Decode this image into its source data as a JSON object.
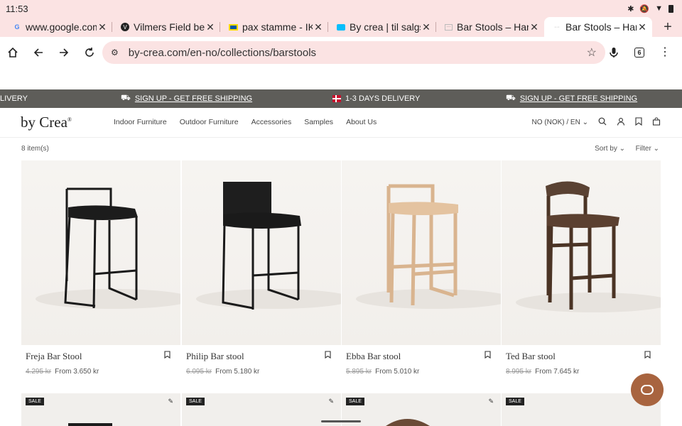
{
  "status": {
    "time": "11:53"
  },
  "tabs": [
    {
      "title": "www.google.com",
      "favicon": "google-icon"
    },
    {
      "title": "Vilmers Field beige",
      "favicon": "vilmers-icon"
    },
    {
      "title": "pax stamme - IKEA",
      "favicon": "ikea-icon"
    },
    {
      "title": "By crea | til salgs",
      "favicon": "finn-icon"
    },
    {
      "title": "Bar Stools – Handm",
      "favicon": "bycrea-icon"
    },
    {
      "title": "Bar Stools – Handm",
      "favicon": "bycrea-icon"
    }
  ],
  "toolbar": {
    "url": "by-crea.com/en-no/collections/barstools",
    "tab_count": "6"
  },
  "announcement": {
    "left_fragment": "LIVERY",
    "signup": "SIGN UP - GET FREE SHIPPING",
    "delivery": "1-3 DAYS DELIVERY",
    "signup2": "SIGN UP - GET FREE SHIPPING"
  },
  "header": {
    "logo": "by Crea",
    "logo_mark": "®",
    "nav": [
      "Indoor Furniture",
      "Outdoor Furniture",
      "Accessories",
      "Samples",
      "About Us"
    ],
    "locale": "NO (NOK) / EN"
  },
  "listing": {
    "count": "8 item(s)",
    "sort": "Sort by",
    "filter": "Filter"
  },
  "products": [
    {
      "name": "Freja Bar Stool",
      "old_price": "4.295 kr",
      "price": "From 3.650 kr"
    },
    {
      "name": "Philip Bar stool",
      "old_price": "6.095 kr",
      "price": "From 5.180 kr"
    },
    {
      "name": "Ebba Bar stool",
      "old_price": "5.895 kr",
      "price": "From 5.010 kr"
    },
    {
      "name": "Ted Bar stool",
      "old_price": "8.995 kr",
      "price": "From 7.645 kr"
    }
  ],
  "sale_badge": "SALE",
  "colors": {
    "announcement_bg": "#5e5d59",
    "chrome_bg": "#fbe3e3",
    "chat": "#a8643f"
  }
}
